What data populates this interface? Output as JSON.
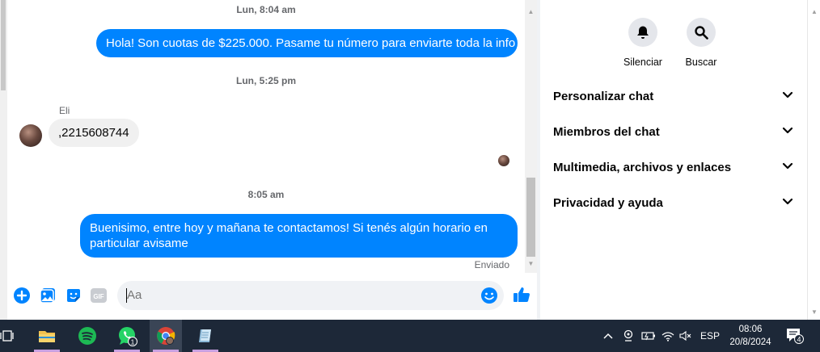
{
  "chat": {
    "stamp1": "Lun, 8:04 am",
    "msg1": "Hola! Son cuotas de $225.000. Pasame tu número para enviarte toda la info",
    "stamp2": "Lun, 5:25 pm",
    "sender_name": "Eli",
    "msg2": ",2215608744",
    "stamp3": "8:05 am",
    "msg3": "Buenisimo, entre hoy y mañana te contactamos! Si tenés algún horario en particular avisame",
    "status": "Enviado"
  },
  "composer": {
    "placeholder": "Aa",
    "icons": [
      "plus-circle-icon",
      "image-icon",
      "sticker-icon",
      "gif-icon",
      "emoji-icon",
      "thumbs-up-icon"
    ],
    "gif_label": "GIF"
  },
  "panel": {
    "actions": [
      {
        "label": "Silenciar",
        "icon": "bell-icon"
      },
      {
        "label": "Buscar",
        "icon": "search-icon"
      }
    ],
    "sections": [
      {
        "label": "Personalizar chat"
      },
      {
        "label": "Miembros del chat"
      },
      {
        "label": "Multimedia, archivos y enlaces"
      },
      {
        "label": "Privacidad y ayuda"
      }
    ]
  },
  "taskbar": {
    "apps": [
      "task-view-icon",
      "file-explorer-icon",
      "spotify-icon",
      "whatsapp-icon",
      "chrome-icon",
      "notepad-icon"
    ],
    "whatsapp_badge": "1",
    "language": "ESP",
    "time": "08:06",
    "date": "20/8/2024",
    "notification_count": "4"
  },
  "colors": {
    "accent": "#0084ff",
    "incoming_bubble": "#f0f0f0",
    "taskbar": "#1d2838"
  }
}
